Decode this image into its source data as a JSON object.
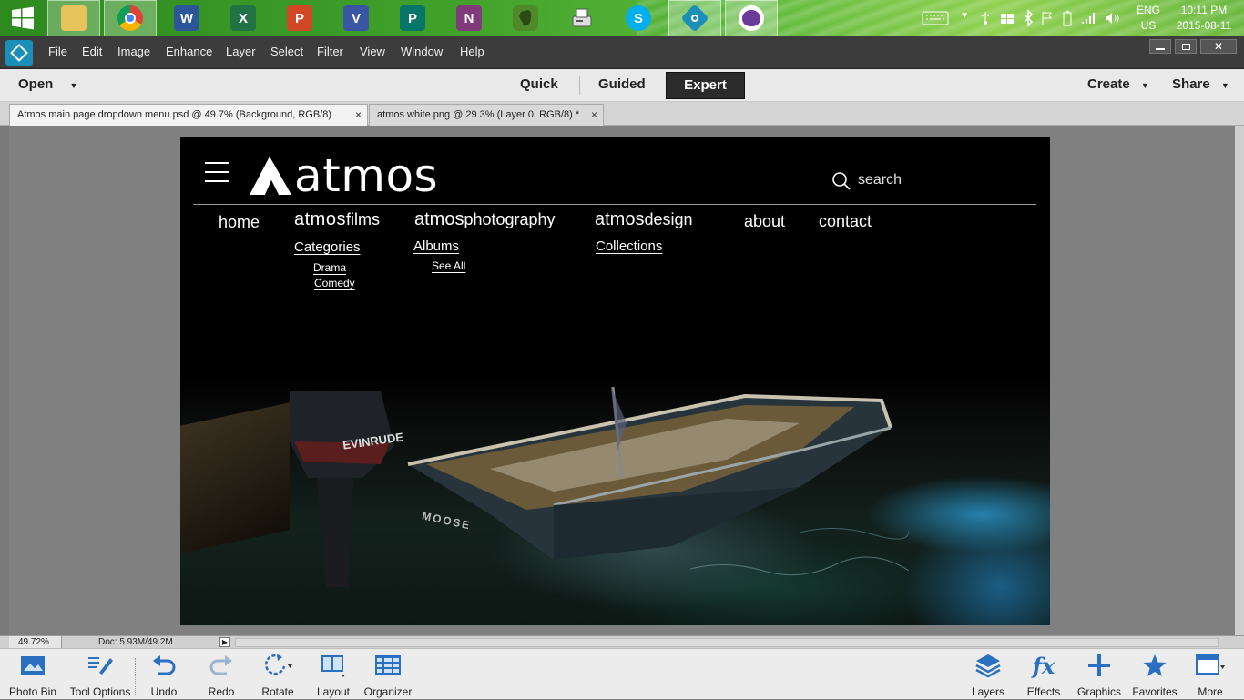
{
  "taskbar": {
    "apps": [
      {
        "icon": "file-explorer-icon",
        "label": ""
      },
      {
        "icon": "chrome-icon",
        "label": ""
      },
      {
        "icon": "word-icon",
        "label": "W"
      },
      {
        "icon": "excel-icon",
        "label": "X"
      },
      {
        "icon": "powerpoint-icon",
        "label": "P"
      },
      {
        "icon": "visio-icon",
        "label": "V"
      },
      {
        "icon": "publisher-icon",
        "label": "P"
      },
      {
        "icon": "onenote-icon",
        "label": "N"
      },
      {
        "icon": "evernote-icon",
        "label": ""
      },
      {
        "icon": "fax-icon",
        "label": ""
      },
      {
        "icon": "skype-icon",
        "label": "S"
      },
      {
        "icon": "photoshop-elements-icon",
        "label": ""
      },
      {
        "icon": "cat-app-icon",
        "label": ""
      }
    ],
    "lang_top": "ENG",
    "lang_bottom": "US",
    "time": "10:11 PM",
    "date": "2015-08-11"
  },
  "menubar": {
    "items": [
      "File",
      "Edit",
      "Image",
      "Enhance",
      "Layer",
      "Select",
      "Filter",
      "View",
      "Window",
      "Help"
    ]
  },
  "modebar": {
    "open": "Open",
    "modes": [
      "Quick",
      "Guided",
      "Expert"
    ],
    "active_mode": "Expert",
    "create": "Create",
    "share": "Share"
  },
  "doc_tabs": [
    {
      "label": "Atmos main page dropdown menu.psd @ 49.7% (Background, RGB/8)",
      "active": true
    },
    {
      "label": "atmos white.png @ 29.3% (Layer 0, RGB/8) *",
      "active": false
    }
  ],
  "site": {
    "logo": "atmos",
    "search": "search",
    "nav": {
      "home": "home",
      "films_prefix": "atmos",
      "films": "films",
      "photo_prefix": "atmos",
      "photo": "photography",
      "design_prefix": "atmos",
      "design": "design",
      "about": "about",
      "contact": "contact"
    },
    "films_sub": "Categories",
    "films_items": [
      "Drama",
      "Comedy"
    ],
    "photo_sub": "Albums",
    "photo_items": [
      "See All"
    ],
    "design_sub": "Collections",
    "boat_text_1": "EVINRUDE",
    "boat_text_2": "MOOSE"
  },
  "status": {
    "zoom": "49.72%",
    "doc": "Doc: 5.93M/49.2M"
  },
  "bottombar": {
    "left": [
      {
        "icon": "photo-bin-icon",
        "label": "Photo Bin"
      },
      {
        "icon": "tool-options-icon",
        "label": "Tool Options"
      },
      {
        "icon": "undo-icon",
        "label": "Undo"
      },
      {
        "icon": "redo-icon",
        "label": "Redo"
      },
      {
        "icon": "rotate-icon",
        "label": "Rotate"
      },
      {
        "icon": "layout-icon",
        "label": "Layout"
      },
      {
        "icon": "organizer-icon",
        "label": "Organizer"
      }
    ],
    "right": [
      {
        "icon": "layers-icon",
        "label": "Layers"
      },
      {
        "icon": "effects-icon",
        "label": "Effects"
      },
      {
        "icon": "graphics-icon",
        "label": "Graphics"
      },
      {
        "icon": "favorites-icon",
        "label": "Favorites"
      },
      {
        "icon": "more-icon",
        "label": "More"
      }
    ]
  },
  "colors": {
    "accent_blue": "#2a6fc0",
    "menubar": "#3c3c3c",
    "canvas": "#000000"
  }
}
